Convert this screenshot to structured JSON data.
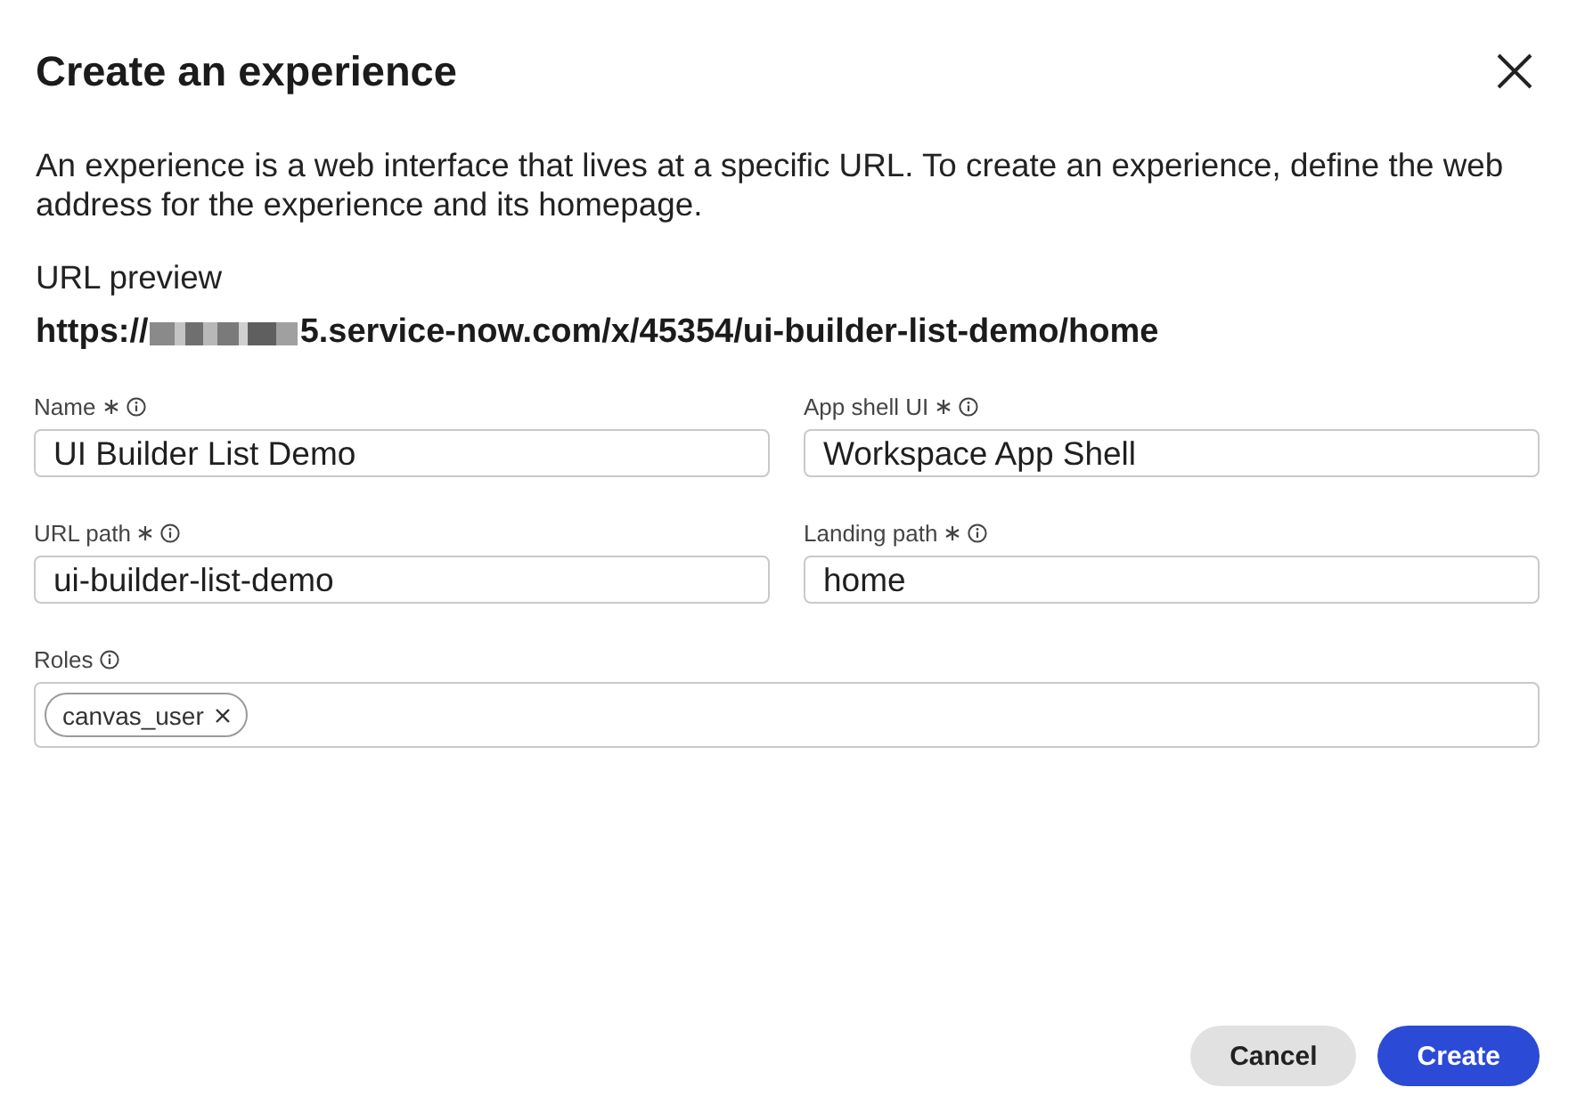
{
  "dialog": {
    "title": "Create an experience",
    "description": "An experience is a web interface that lives at a specific URL. To create an experience, define the web address for the experience and its homepage."
  },
  "url_preview": {
    "label": "URL preview",
    "prefix": "https://",
    "redacted": true,
    "suffix": "5.service-now.com/x/45354/ui-builder-list-demo/home"
  },
  "fields": [
    {
      "kind": "text",
      "label": "Name",
      "required": true,
      "value": "UI Builder List Demo"
    },
    {
      "kind": "text",
      "label": "App shell UI",
      "required": true,
      "value": "Workspace App Shell"
    },
    {
      "kind": "text",
      "label": "URL path",
      "required": true,
      "value": "ui-builder-list-demo"
    },
    {
      "kind": "text",
      "label": "Landing path",
      "required": true,
      "value": "home"
    },
    {
      "kind": "tags",
      "label": "Roles",
      "required": false,
      "tags": [
        "canvas_user"
      ]
    }
  ],
  "buttons": [
    {
      "label": "Cancel",
      "kind": "secondary"
    },
    {
      "label": "Create",
      "kind": "primary"
    }
  ]
}
